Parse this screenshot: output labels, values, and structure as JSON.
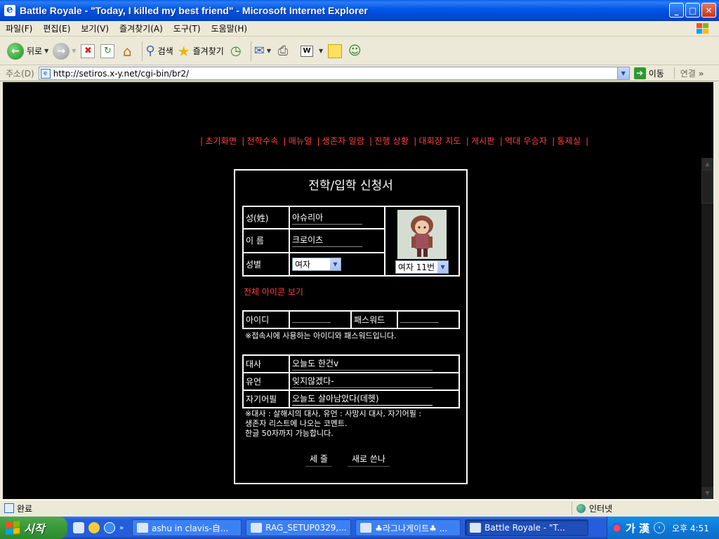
{
  "window": {
    "title": "Battle Royale - \"Today, I killed my best friend\" - Microsoft Internet Explorer",
    "minimize": "_",
    "maximize": "□",
    "close": "✕"
  },
  "menu": {
    "items": [
      "파일(F)",
      "편집(E)",
      "보기(V)",
      "즐겨찾기(A)",
      "도구(T)",
      "도움말(H)"
    ]
  },
  "toolbar": {
    "back": "뒤로",
    "search": "검색",
    "favorites": "즐겨찾기"
  },
  "address": {
    "label": "주소(D)",
    "url": "http://setiros.x-y.net/cgi-bin/br2/",
    "go": "이동",
    "links": "연결",
    "more": "»"
  },
  "page": {
    "nav_links": [
      "초기화면",
      "전학수속",
      "매뉴얼",
      "생존자 일람",
      "진행 상황",
      "대회장 지도",
      "게시판",
      "역대 우승자",
      "통제실"
    ],
    "form_title": "전학/입학 신청서",
    "surname_label": "성(姓)",
    "surname_value": "아슈리아",
    "name_label": "이 름",
    "name_value": "크로이츠",
    "gender_label": "성별",
    "gender_value": "여자",
    "icon_select": "여자 11번",
    "view_icons": "전체 아이콘 보기",
    "id_label": "아이디",
    "id_value": "",
    "password_label": "패스워드",
    "password_value": "",
    "id_note": "※접속시에 사용하는 아이디와 패스워드입니다.",
    "line_label": "대사",
    "line_value": "오늘도 한건v",
    "will_label": "유언",
    "will_value": "잊지않겠다-",
    "intro_label": "자기어필",
    "intro_value": "오늘도 살아남았다(데헷)",
    "notes": [
      "※대사 : 살해시의 대사, 유언 : 사망시 대사, 자기어필 :",
      "생존자 리스트에 나오는 코멘트.",
      "한글 50자까지 가능합니다."
    ],
    "submit": "세 줄",
    "reset": "새로 쓴나"
  },
  "status": {
    "text": "완료",
    "zone": "인터넷"
  },
  "taskbar": {
    "start": "시작",
    "tasks": [
      "ashu in clavis-自...",
      "RAG_SETUP0329,...",
      "♣라그나게이트♣ ...",
      "Battle Royale - \"T..."
    ],
    "ime": "가 漢",
    "clock": "오후 4:51"
  },
  "colors": {
    "link_red": "#ff4040",
    "page_bg": "#000000",
    "titlebar_blue": "#0055e5"
  }
}
